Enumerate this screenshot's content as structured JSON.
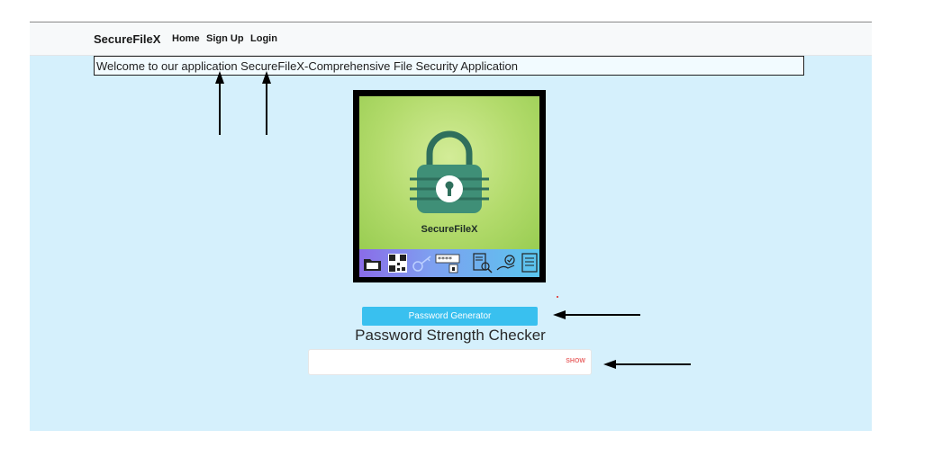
{
  "app": {
    "brand": "SecureFileX"
  },
  "nav": {
    "items": [
      {
        "label": "Home"
      },
      {
        "label": "Sign Up"
      },
      {
        "label": "Login"
      }
    ]
  },
  "welcome": {
    "text": "Welcome to our application SecureFileX-Comprehensive File Security Application"
  },
  "logo": {
    "caption": "SecureFileX",
    "icons": [
      "folder-icon",
      "qr-code-icon",
      "key-icon",
      "password-icon",
      "document-search-icon",
      "secure-hand-icon",
      "document-icon"
    ]
  },
  "password_generator": {
    "label": "Password Generator"
  },
  "strength_checker": {
    "title": "Password Strength Checker",
    "input_value": "",
    "show_label": "SHOW"
  },
  "colors": {
    "background": "#d5f0fc",
    "button": "#39c0ef",
    "show": "#ea6c6c",
    "logo_green": "#3f8f77"
  }
}
